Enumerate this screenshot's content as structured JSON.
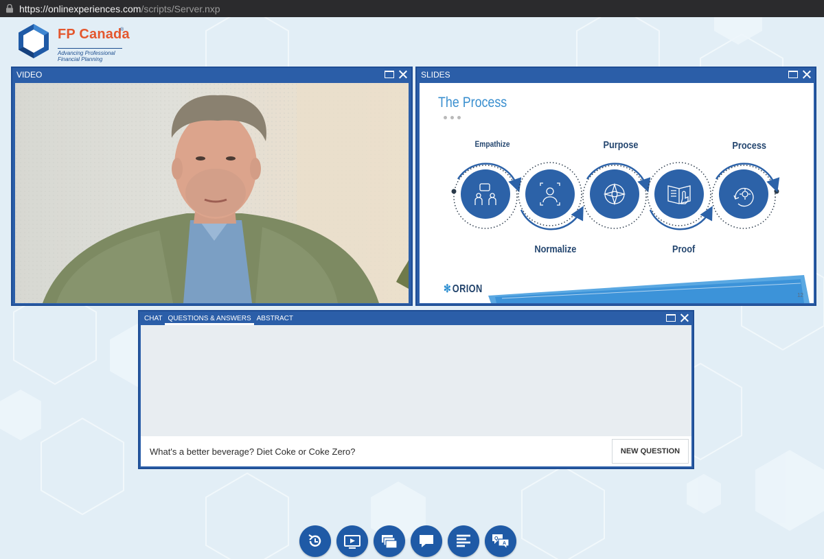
{
  "browser": {
    "url_host": "https://onlinexperiences.com",
    "url_path": "/scripts/Server.nxp"
  },
  "logo": {
    "name": "FP Canada",
    "registered": "®",
    "tagline_line1": "Advancing Professional",
    "tagline_line2": "Financial Planning"
  },
  "video_panel": {
    "title": "VIDEO"
  },
  "slides_panel": {
    "title": "SLIDES",
    "slide": {
      "title": "The Process",
      "steps": [
        "Empathize",
        "Normalize",
        "Purpose",
        "Proof",
        "Process"
      ],
      "brand": "ORION",
      "page_number": "12"
    }
  },
  "qa_panel": {
    "tabs": [
      {
        "label": "CHAT",
        "active": false
      },
      {
        "label": "QUESTIONS & ANSWERS",
        "active": true
      },
      {
        "label": "ABSTRACT",
        "active": false
      }
    ],
    "input_value": "What's a better beverage? Diet Coke or Coke Zero?",
    "submit_label": "NEW QUESTION"
  },
  "toolbar": {
    "buttons": [
      "refresh-icon",
      "video-icon",
      "slides-icon",
      "chat-icon",
      "agenda-icon",
      "qa-icon"
    ]
  },
  "colors": {
    "panel_blue": "#2b5ea8",
    "brand_orange": "#e4572e",
    "slide_blue": "#2c62a8",
    "background": "#e2eef6"
  }
}
